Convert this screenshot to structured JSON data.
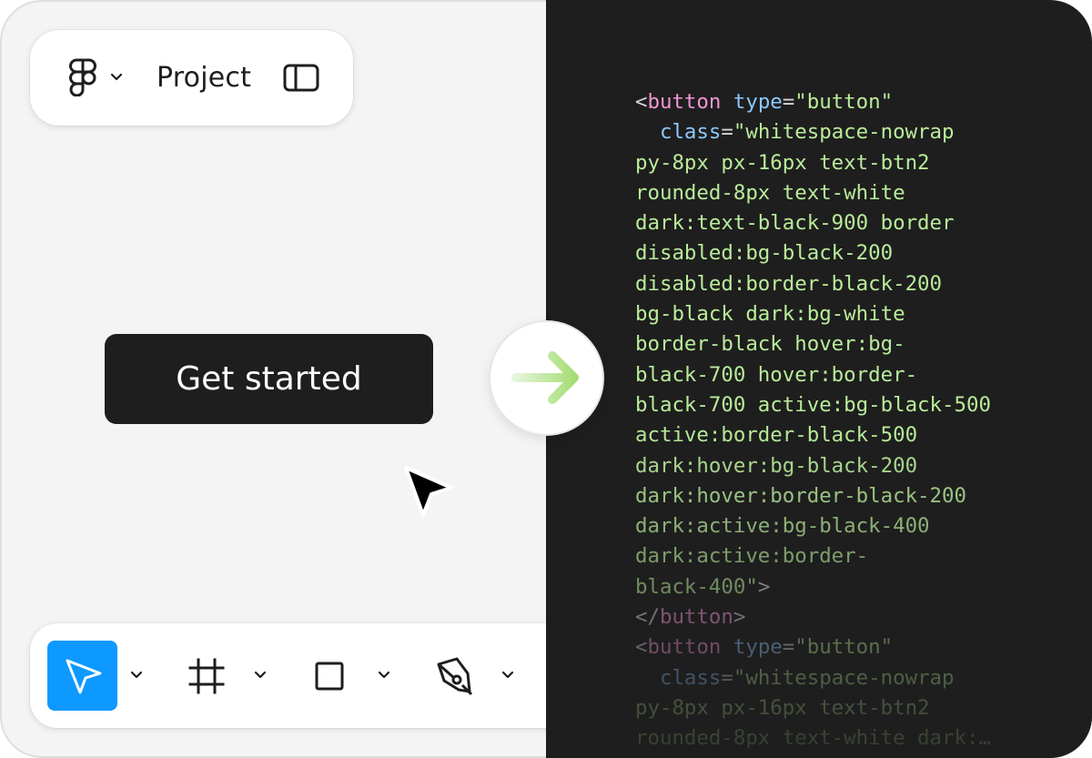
{
  "header": {
    "project_title": "Project",
    "logo_icon": "figma-logo-icon",
    "menu_icon": "chevron-down-icon",
    "panel_icon": "sidebar-panel-icon"
  },
  "canvas": {
    "button_label": "Get started",
    "cursor_icon": "pointer-cursor-icon"
  },
  "toolbar": {
    "tools": [
      {
        "name": "move",
        "icon": "move-arrow-icon",
        "active": true
      },
      {
        "name": "frame",
        "icon": "frame-hash-icon",
        "active": false
      },
      {
        "name": "rectangle",
        "icon": "square-icon",
        "active": false
      },
      {
        "name": "pen",
        "icon": "pen-nib-icon",
        "active": false
      }
    ],
    "active_color": "#0d99ff"
  },
  "transition": {
    "icon": "arrow-right-icon"
  },
  "code": {
    "lines": [
      {
        "parts": [
          {
            "t": "<",
            "k": "punc"
          },
          {
            "t": "button",
            "k": "tag"
          },
          {
            "t": " ",
            "k": "punc"
          },
          {
            "t": "type",
            "k": "attr"
          },
          {
            "t": "=",
            "k": "punc"
          },
          {
            "t": "\"button\"",
            "k": "str"
          }
        ]
      },
      {
        "parts": [
          {
            "t": "  ",
            "k": "punc"
          },
          {
            "t": "class",
            "k": "attr"
          },
          {
            "t": "=",
            "k": "punc"
          },
          {
            "t": "\"whitespace-nowrap",
            "k": "str"
          }
        ]
      },
      {
        "parts": [
          {
            "t": "py-8px px-16px text-btn2",
            "k": "str"
          }
        ]
      },
      {
        "parts": [
          {
            "t": "rounded-8px text-white",
            "k": "str"
          }
        ]
      },
      {
        "parts": [
          {
            "t": "dark:text-black-900 border",
            "k": "str"
          }
        ]
      },
      {
        "parts": [
          {
            "t": "disabled:bg-black-200",
            "k": "str"
          }
        ]
      },
      {
        "parts": [
          {
            "t": "disabled:border-black-200",
            "k": "str"
          }
        ]
      },
      {
        "parts": [
          {
            "t": "bg-black dark:bg-white",
            "k": "str"
          }
        ]
      },
      {
        "parts": [
          {
            "t": "border-black hover:bg-",
            "k": "str"
          }
        ]
      },
      {
        "parts": [
          {
            "t": "black-700 hover:border-",
            "k": "str"
          }
        ]
      },
      {
        "parts": [
          {
            "t": "black-700 active:bg-black-500",
            "k": "str"
          }
        ]
      },
      {
        "parts": [
          {
            "t": "active:border-black-500",
            "k": "str"
          }
        ]
      },
      {
        "parts": [
          {
            "t": "dark:hover:bg-black-200",
            "k": "str"
          }
        ]
      },
      {
        "parts": [
          {
            "t": "dark:hover:border-black-200",
            "k": "str"
          }
        ]
      },
      {
        "parts": [
          {
            "t": "dark:active:bg-black-400",
            "k": "str"
          }
        ]
      },
      {
        "parts": [
          {
            "t": "dark:active:border-",
            "k": "str"
          }
        ]
      },
      {
        "parts": [
          {
            "t": "black-400\"",
            "k": "str"
          },
          {
            "t": ">",
            "k": "punc"
          }
        ]
      },
      {
        "parts": [
          {
            "t": "</",
            "k": "punc"
          },
          {
            "t": "button",
            "k": "tag"
          },
          {
            "t": ">",
            "k": "punc"
          }
        ]
      },
      {
        "parts": [
          {
            "t": "<",
            "k": "punc"
          },
          {
            "t": "button",
            "k": "tag"
          },
          {
            "t": " ",
            "k": "punc"
          },
          {
            "t": "type",
            "k": "attr"
          },
          {
            "t": "=",
            "k": "punc"
          },
          {
            "t": "\"button\"",
            "k": "str"
          }
        ]
      },
      {
        "parts": [
          {
            "t": "  ",
            "k": "punc"
          },
          {
            "t": "class",
            "k": "attr"
          },
          {
            "t": "=",
            "k": "punc"
          },
          {
            "t": "\"whitespace-nowrap",
            "k": "str"
          }
        ]
      },
      {
        "parts": [
          {
            "t": "py-8px px-16px text-btn2",
            "k": "str"
          }
        ]
      },
      {
        "parts": [
          {
            "t": "rounded-8px text-white dark:…",
            "k": "str"
          }
        ]
      }
    ]
  }
}
